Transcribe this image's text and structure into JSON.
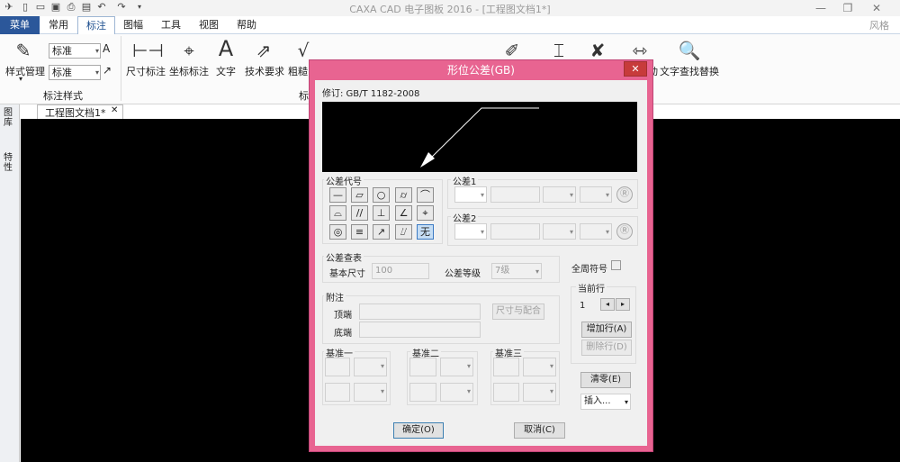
{
  "app": {
    "title": "CAXA CAD 电子图板 2016 - [工程图文档1*]",
    "style_label": "风格"
  },
  "menu": {
    "main_button": "菜单",
    "tabs": [
      {
        "label": "常用"
      },
      {
        "label": "标注"
      },
      {
        "label": "图幅"
      },
      {
        "label": "工具"
      },
      {
        "label": "视图"
      },
      {
        "label": "帮助"
      }
    ],
    "active_tab": "标注"
  },
  "ribbon": {
    "style_group": {
      "manager_label": "样式管理",
      "combo1": "标准",
      "combo2": "标准",
      "group_label": "标注样式"
    },
    "tools": [
      {
        "label": "尺寸标注"
      },
      {
        "label": "坐标标注"
      },
      {
        "label": "文字"
      },
      {
        "label": "技术要求"
      },
      {
        "label": "粗糙度"
      },
      {
        "label": "动"
      },
      {
        "label": "文字查找替换"
      }
    ],
    "group2_label": "标"
  },
  "doc": {
    "tab_label": "工程图文档1*",
    "side_tabs": [
      "图库",
      "特性"
    ]
  },
  "dialog": {
    "title": "形位公差(GB)",
    "close": "✕",
    "revision": "修订: GB/T 1182-2008",
    "tol_code_label": "公差代号",
    "symbols": [
      "—",
      "▱",
      "○",
      "⌭",
      "⌒",
      "⌓",
      "//",
      "⊥",
      "∠",
      "⌖",
      "◎",
      "≡",
      "↗",
      "⌰",
      "无"
    ],
    "selected_symbol": "无",
    "tol1_label": "公差1",
    "tol2_label": "公差2",
    "reg_symbol": "Ⓡ",
    "lookup_label": "公差查表",
    "basic_size_label": "基本尺寸",
    "basic_size": "100",
    "grade_label": "公差等级",
    "grade": "7级",
    "all_around_label": "全周符号",
    "note_label": "附注",
    "top_label": "顶端",
    "bottom_label": "底端",
    "size_fit_button": "尺寸与配合",
    "current_row_label": "当前行",
    "current_row": "1",
    "add_row": "增加行(A)",
    "del_row": "删除行(D)",
    "datum1": "基准一",
    "datum2": "基准二",
    "datum3": "基准三",
    "clear": "清零(E)",
    "insert": "插入...",
    "ok": "确定(O)",
    "cancel": "取消(C)"
  }
}
